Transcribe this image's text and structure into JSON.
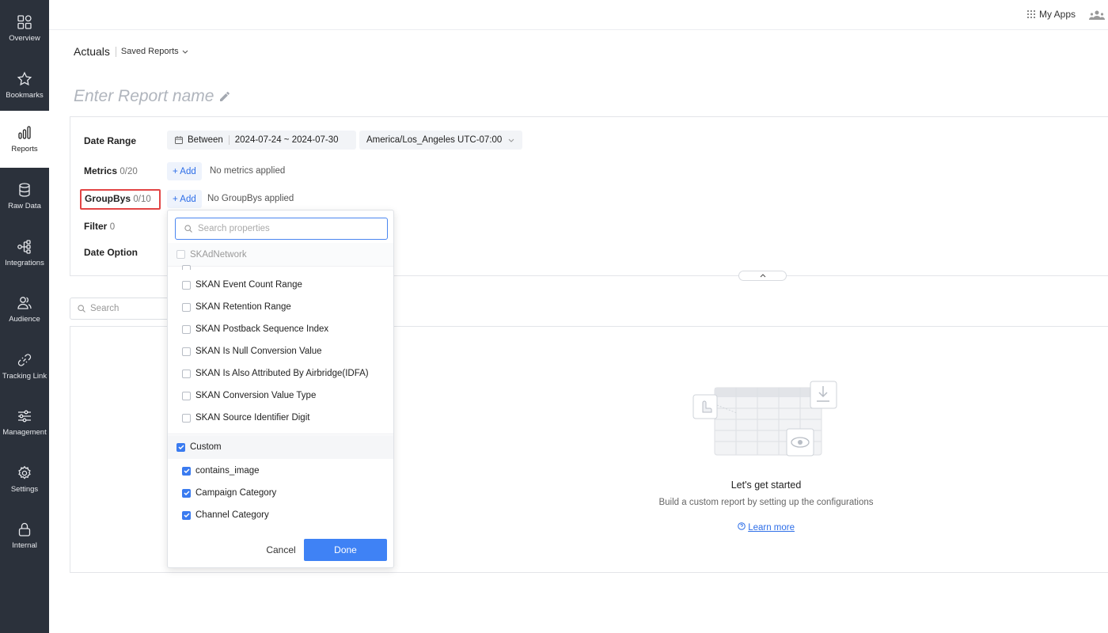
{
  "sidebar": {
    "items": [
      {
        "label": "Overview",
        "icon": "grid-icon"
      },
      {
        "label": "Bookmarks",
        "icon": "star-icon"
      },
      {
        "label": "Reports",
        "icon": "bar-chart-icon",
        "active": true
      },
      {
        "label": "Raw Data",
        "icon": "database-icon"
      },
      {
        "label": "Integrations",
        "icon": "integrations-icon"
      },
      {
        "label": "Audience",
        "icon": "users-icon"
      },
      {
        "label": "Tracking Link",
        "icon": "link-icon"
      },
      {
        "label": "Management",
        "icon": "sliders-icon"
      },
      {
        "label": "Settings",
        "icon": "gear-icon"
      },
      {
        "label": "Internal",
        "icon": "lock-icon"
      }
    ]
  },
  "topbar": {
    "my_apps": "My Apps"
  },
  "header": {
    "title": "Actuals",
    "saved_reports": "Saved Reports",
    "report_name_placeholder": "Enter Report name"
  },
  "config": {
    "date_range": {
      "label": "Date Range",
      "mode": "Between",
      "range": "2024-07-24 ~ 2024-07-30",
      "timezone": "America/Los_Angeles UTC-07:00"
    },
    "metrics": {
      "label": "Metrics",
      "count": "0/20",
      "add": "+ Add",
      "empty": "No metrics applied"
    },
    "groupbys": {
      "label": "GroupBys",
      "count": "0/10",
      "add": "+ Add",
      "empty": "No GroupBys applied"
    },
    "filter": {
      "label": "Filter",
      "count": "0"
    },
    "date_option": {
      "label": "Date Option"
    }
  },
  "table_search": {
    "placeholder": "Search"
  },
  "empty_state": {
    "title": "Let's get started",
    "subtitle": "Build a custom report by setting up the configurations",
    "learn_more": "Learn more"
  },
  "dropdown": {
    "search_placeholder": "Search properties",
    "groups": [
      {
        "name": "SKAdNetwork",
        "checked": false,
        "options": [
          {
            "label": "SKAN Event Count Range",
            "checked": false
          },
          {
            "label": "SKAN Retention Range",
            "checked": false
          },
          {
            "label": "SKAN Postback Sequence Index",
            "checked": false
          },
          {
            "label": "SKAN Is Null Conversion Value",
            "checked": false
          },
          {
            "label": "SKAN Is Also Attributed By Airbridge(IDFA)",
            "checked": false
          },
          {
            "label": "SKAN Conversion Value Type",
            "checked": false
          },
          {
            "label": "SKAN Source Identifier Digit",
            "checked": false
          }
        ]
      },
      {
        "name": "Custom",
        "checked": true,
        "options": [
          {
            "label": "contains_image",
            "checked": true
          },
          {
            "label": "Campaign Category",
            "checked": true
          },
          {
            "label": "Channel Category",
            "checked": true
          }
        ]
      }
    ],
    "cancel": "Cancel",
    "done": "Done"
  },
  "colors": {
    "sidebar_bg": "#2b313b",
    "accent": "#3f82f5",
    "highlight": "#e24545"
  }
}
